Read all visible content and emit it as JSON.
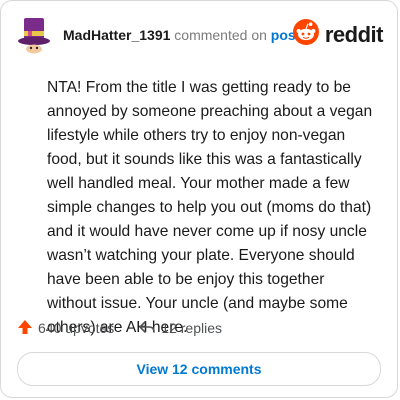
{
  "header": {
    "username": "MadHatter_1391",
    "commented_text": " commented on ",
    "post_link": "post",
    "brand_name": "reddit"
  },
  "comment": {
    "text": "NTA! From the title I was getting ready to be annoyed by someone preaching about a vegan lifestyle while others try to enjoy non-vegan food, but it sounds like this was a fantastically well handled meal. Your mother made a few simple changes to help you out (moms do that) and it would have never come up if nosy uncle wasn’t watching your plate. Everyone should have been able to be enjoy this together without issue. Your uncle (and maybe some others) are AH here."
  },
  "actions": {
    "upvotes": "640 upvotes",
    "replies": "12 replies"
  },
  "footer": {
    "view_button": "View 12 comments"
  },
  "icons": {
    "avatar": "mad-hatter-top-hat-avatar",
    "brand": "reddit-snoo-logo",
    "upvote": "upvote-arrow-icon",
    "reply": "reply-arrow-icon"
  },
  "colors": {
    "accent": "#0079d3",
    "upvote": "#ff4500",
    "hat": "#7b2c8b",
    "brand": "#ff4500"
  }
}
